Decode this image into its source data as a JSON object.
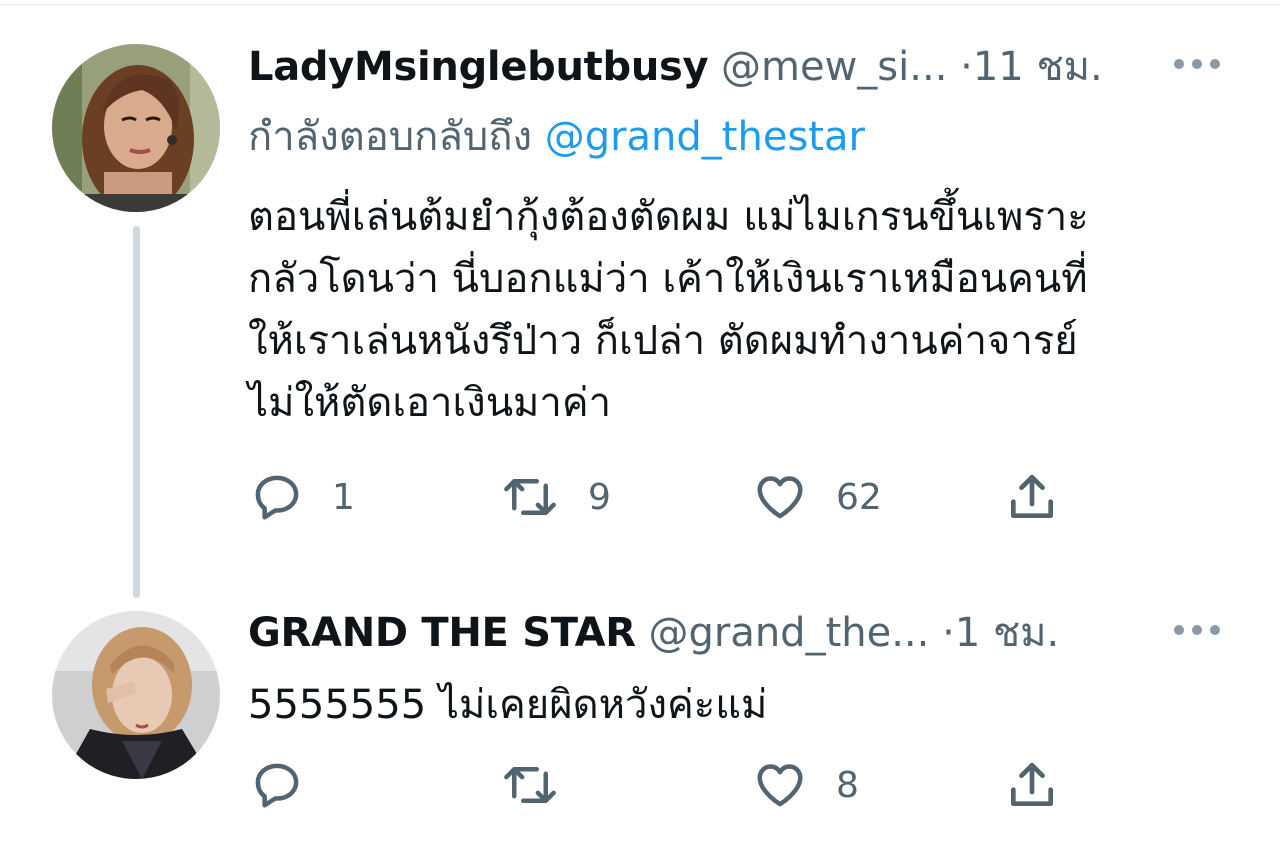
{
  "tweets": [
    {
      "display_name": "LadyMsinglebutbusy",
      "handle": "@mew_si...",
      "separator": "·",
      "time": "11 ชม.",
      "reply_prefix": "กำลังตอบกลับถึง",
      "reply_mention": "@grand_thestar",
      "text_lines": [
        "ตอนพี่เล่นต้มยำกุ้งต้องตัดผม แม่ไมเกรนขึ้นเพราะ",
        "กลัวโดนว่า นี่บอกแม่ว่า เค้าให้เงินเราเหมือนคนที่",
        "ให้เราเล่นหนังรึป่าว ก็เปล่า ตัดผมทำงานค่าจารย์",
        "ไม่ให้ตัดเอาเงินมาค่า"
      ],
      "reply_count": "1",
      "retweet_count": "9",
      "like_count": "62"
    },
    {
      "display_name": "GRAND THE STAR",
      "handle": "@grand_the...",
      "separator": "·",
      "time": "1 ชม.",
      "text_lines": [
        "5555555 ไม่เคยผิดหวังค่ะแม่"
      ],
      "like_count": "8"
    }
  ],
  "icons": {
    "reply": "reply-icon",
    "retweet": "retweet-icon",
    "like": "heart-icon",
    "share": "share-icon",
    "more": "more-icon"
  },
  "colors": {
    "text": "#0f1419",
    "secondary": "#536471",
    "link": "#1d9bf0",
    "thread_line": "#cfd9de"
  }
}
